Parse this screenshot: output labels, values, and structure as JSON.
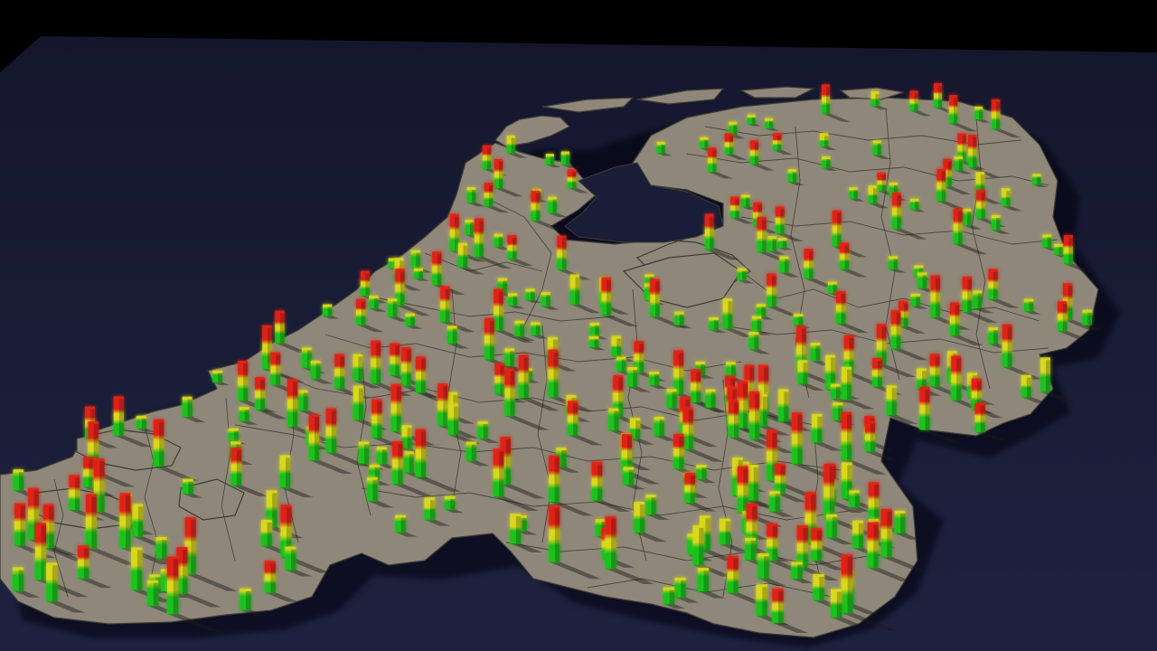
{
  "colors": {
    "background": "#000000",
    "plane": "#1a1d38",
    "land": "#8f887a",
    "border": "#3f3b34",
    "bar_low": "#1ec21e",
    "bar_mid": "#d8d81e",
    "bar_high": "#e02318"
  },
  "bar_encoding": {
    "levels": [
      "low",
      "mid",
      "high"
    ]
  }
}
